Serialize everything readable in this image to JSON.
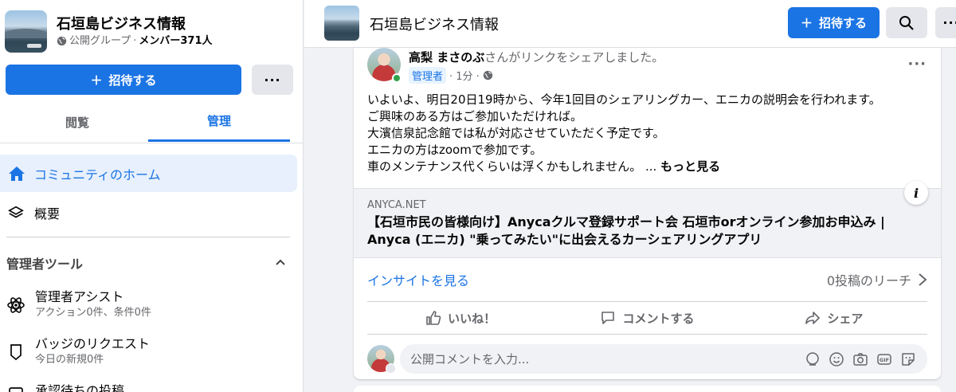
{
  "group": {
    "title": "石垣島ビジネス情報",
    "privacy": "公開グループ",
    "separator": "·",
    "members": "メンバー371人"
  },
  "sidebar": {
    "invite_label": "招待する",
    "more_label": "···",
    "tabs": [
      "閲覧",
      "管理"
    ],
    "active_tab": "管理",
    "nav_home": "コミュニティのホーム",
    "nav_overview": "概要",
    "admin_tools_heading": "管理者ツール",
    "tools": [
      {
        "title": "管理者アシスト",
        "subtitle": "アクション0件、条件0件"
      },
      {
        "title": "バッジのリクエスト",
        "subtitle": "今日の新規0件"
      },
      {
        "title": "承認待ちの投稿",
        "subtitle": ""
      }
    ]
  },
  "header": {
    "title": "石垣島ビジネス情報",
    "invite_label": "招待する",
    "more_label": "···"
  },
  "post": {
    "author": "高梨 まさのぶ",
    "action_text": "さんがリンクをシェアしました。",
    "badge": "管理者",
    "time": "· 1分 ·",
    "body": [
      "いよいよ、明日20日19時から、今年1回目のシェアリングカー、エニカの説明会を行われます。",
      "ご興味のある方はご参加いただければ。",
      "大濱信泉記念館では私が対応させていただく予定です。",
      "エニカの方はzoomで参加です。",
      "車のメンテナンス代くらいは浮くかもしれません。 ..."
    ],
    "see_more": "もっと見る",
    "link": {
      "domain": "ANYCA.NET",
      "title": "【石垣市民の皆様向け】Anycaクルマ登録サポート会 石垣市orオンライン参加お申込み | Anyca (エニカ) \"乗ってみたい\"に出会えるカーシェアリングアプリ"
    },
    "insights_label": "インサイトを見る",
    "reach_label": "0投稿のリーチ",
    "actions": {
      "like": "いいね！",
      "comment": "コメントする",
      "share": "シェア"
    },
    "comment_placeholder": "公開コメントを入力..."
  },
  "colors": {
    "accent": "#1b74e4",
    "background": "#f0f2f5",
    "online": "#31a24c"
  }
}
